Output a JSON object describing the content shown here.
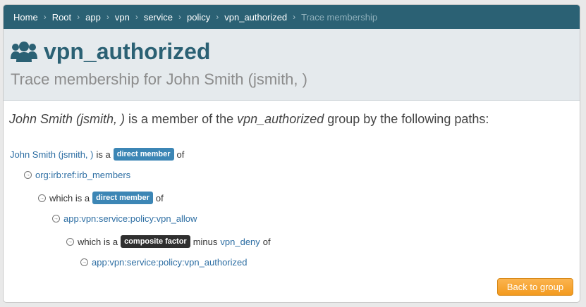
{
  "breadcrumb": {
    "items": [
      "Home",
      "Root",
      "app",
      "vpn",
      "service",
      "policy",
      "vpn_authorized"
    ],
    "current": "Trace membership",
    "separator": "›"
  },
  "header": {
    "title": "vpn_authorized",
    "subtitle": "Trace membership for John Smith (jsmith, )",
    "icon": "users-icon"
  },
  "lead": {
    "member": "John Smith (jsmith, )",
    "middle": " is a member of the ",
    "group": "vpn_authorized",
    "end": " group by the following paths:"
  },
  "paths": {
    "row1": {
      "link": "John Smith (jsmith, )",
      "pre": "is a",
      "badge": "direct member",
      "post": "of"
    },
    "row2": {
      "p1": "org",
      "p2": "irb",
      "p3": "ref",
      "p4": "irb_members",
      "sep": " : "
    },
    "row3": {
      "pre": "which is a",
      "badge": "direct member",
      "post": "of"
    },
    "row4": {
      "p1": "app",
      "p2": "vpn",
      "p3": "service",
      "p4": "policy",
      "p5": "vpn_allow",
      "sep": " : "
    },
    "row5": {
      "pre": "which is a",
      "badge": "composite factor",
      "mid": "minus",
      "link": "vpn_deny",
      "post": "of"
    },
    "row6": {
      "p1": "app",
      "p2": "vpn",
      "p3": "service",
      "p4": "policy",
      "p5": "vpn_authorized",
      "sep": " : "
    }
  },
  "actions": {
    "back_label": "Back to group"
  },
  "colors": {
    "accent": "#2b6174",
    "link": "#2d6ea3",
    "badge_blue": "#3c86b5",
    "badge_dark": "#2f2f2f",
    "button": "#f6a530"
  }
}
